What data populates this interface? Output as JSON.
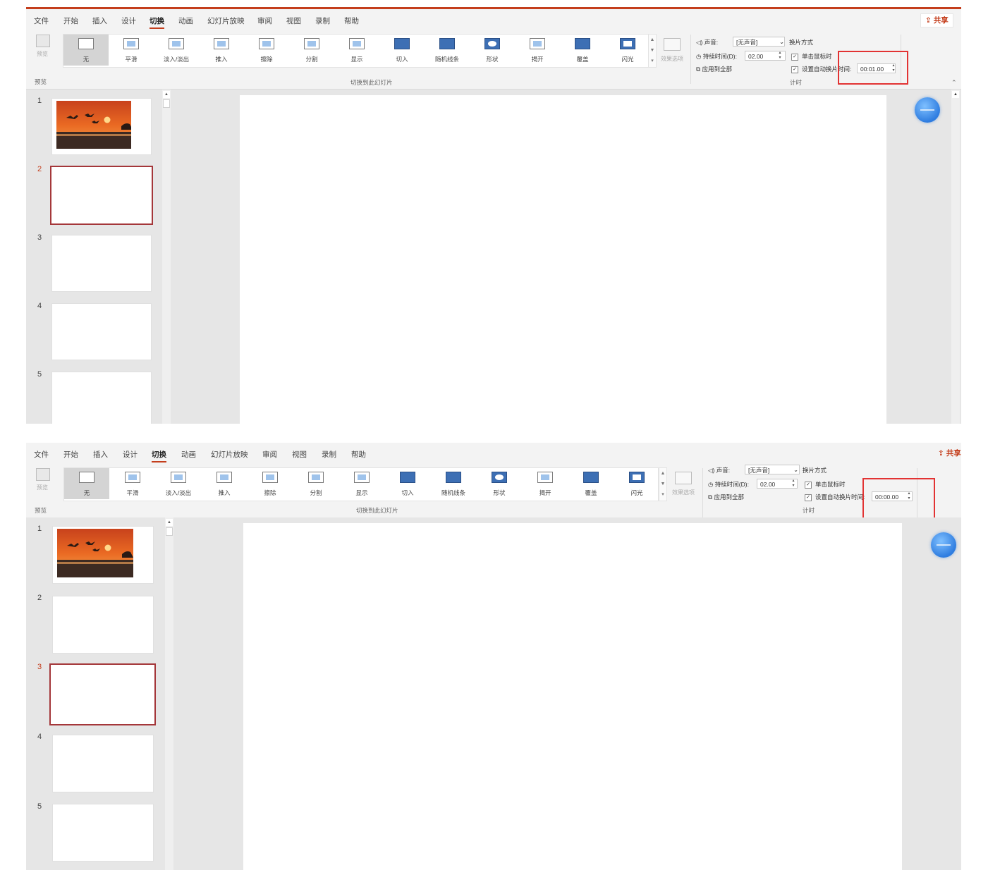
{
  "tabs": [
    "文件",
    "开始",
    "插入",
    "设计",
    "切换",
    "动画",
    "幻灯片放映",
    "审阅",
    "视图",
    "录制",
    "帮助"
  ],
  "active_tab": "切换",
  "share_label": "共享",
  "preview": {
    "label": "预览",
    "group": "预览"
  },
  "gallery": {
    "group_label": "切换到此幻灯片",
    "items": [
      "无",
      "平滑",
      "淡入/淡出",
      "推入",
      "擦除",
      "分割",
      "显示",
      "切入",
      "随机线条",
      "形状",
      "揭开",
      "覆盖",
      "闪光"
    ],
    "selected": "无"
  },
  "effect_options": "效果选项",
  "timing": {
    "group_label": "计时",
    "sound_label": "声音:",
    "sound_value": "[无声音]",
    "duration_label": "持续时间(D):",
    "duration_value": "02.00",
    "apply_all": "应用到全部",
    "advance_label": "换片方式",
    "on_click": "单击鼠标时",
    "auto_after": "设置自动换片时间:"
  },
  "screens": [
    {
      "auto_time": "00:01.00",
      "selected_slide": 2
    },
    {
      "auto_time": "00:00.00",
      "selected_slide": 3
    }
  ],
  "slides": [
    "1",
    "2",
    "3",
    "4",
    "5"
  ],
  "colors": {
    "accent": "#c43e1c",
    "highlight": "#e23333",
    "selected_border": "#a4373a"
  }
}
